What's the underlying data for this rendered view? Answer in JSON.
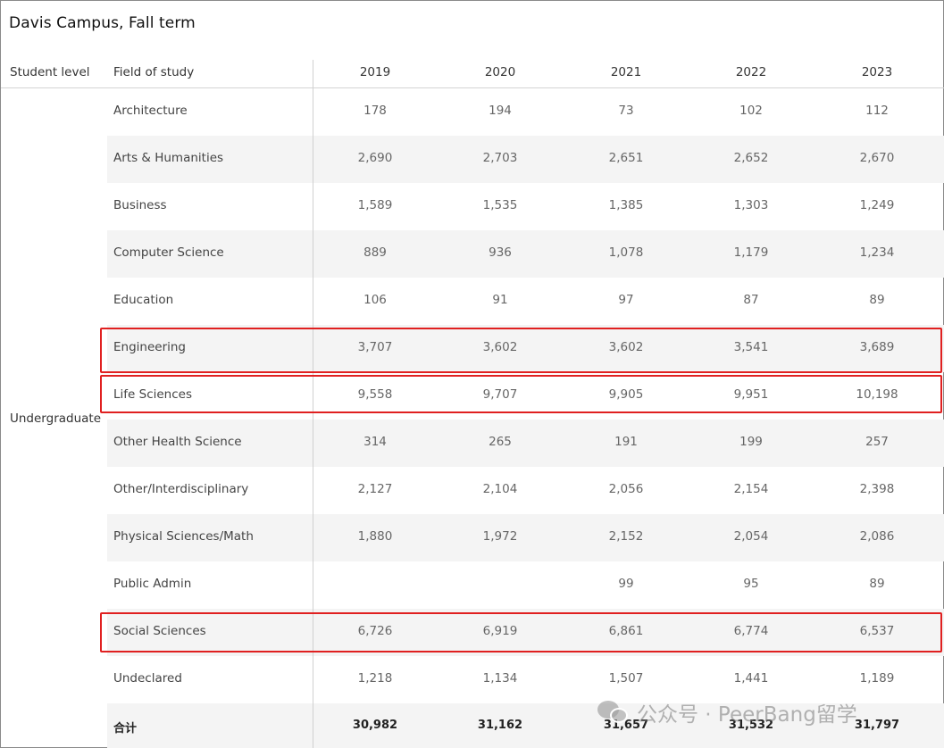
{
  "title": "Davis Campus, Fall term",
  "headers": {
    "student_level": "Student level",
    "field_of_study": "Field of study",
    "years": [
      "2019",
      "2020",
      "2021",
      "2022",
      "2023"
    ]
  },
  "student_level_value": "Undergraduate",
  "rows": [
    {
      "field": "Architecture",
      "values": [
        "178",
        "194",
        "73",
        "102",
        "112"
      ]
    },
    {
      "field": "Arts & Humanities",
      "values": [
        "2,690",
        "2,703",
        "2,651",
        "2,652",
        "2,670"
      ]
    },
    {
      "field": "Business",
      "values": [
        "1,589",
        "1,535",
        "1,385",
        "1,303",
        "1,249"
      ]
    },
    {
      "field": "Computer Science",
      "values": [
        "889",
        "936",
        "1,078",
        "1,179",
        "1,234"
      ]
    },
    {
      "field": "Education",
      "values": [
        "106",
        "91",
        "97",
        "87",
        "89"
      ]
    },
    {
      "field": "Engineering",
      "values": [
        "3,707",
        "3,602",
        "3,602",
        "3,541",
        "3,689"
      ]
    },
    {
      "field": "Life Sciences",
      "values": [
        "9,558",
        "9,707",
        "9,905",
        "9,951",
        "10,198"
      ]
    },
    {
      "field": "Other Health Science",
      "values": [
        "314",
        "265",
        "191",
        "199",
        "257"
      ]
    },
    {
      "field": "Other/Interdisciplinary",
      "values": [
        "2,127",
        "2,104",
        "2,056",
        "2,154",
        "2,398"
      ]
    },
    {
      "field": "Physical Sciences/Math",
      "values": [
        "1,880",
        "1,972",
        "2,152",
        "2,054",
        "2,086"
      ]
    },
    {
      "field": "Public Admin",
      "values": [
        "",
        "",
        "99",
        "95",
        "89"
      ]
    },
    {
      "field": "Social Sciences",
      "values": [
        "6,726",
        "6,919",
        "6,861",
        "6,774",
        "6,537"
      ]
    },
    {
      "field": "Undeclared",
      "values": [
        "1,218",
        "1,134",
        "1,507",
        "1,441",
        "1,189"
      ]
    }
  ],
  "total": {
    "field": "合计",
    "values": [
      "30,982",
      "31,162",
      "31,657",
      "31,532",
      "31,797"
    ]
  },
  "highlighted_rows": [
    "Engineering",
    "Life Sciences",
    "Social Sciences"
  ],
  "highlight_color": "#e02020",
  "watermark": {
    "icon": "wechat-icon",
    "text": "公众号 · PeerBang留学"
  }
}
